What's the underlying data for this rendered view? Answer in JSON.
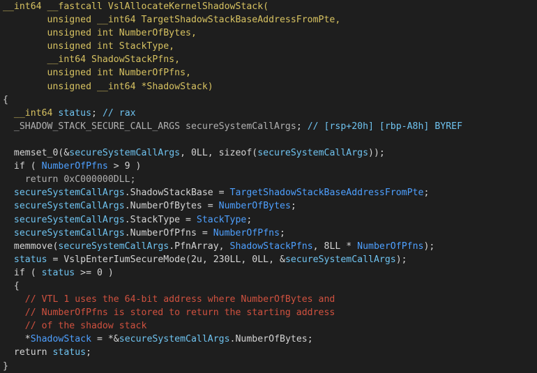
{
  "theme": {
    "background": "#1e1e1e",
    "colors": {
      "keyword": "#d7c261",
      "plain": "#d4d4d4",
      "local": "#6fc3f0",
      "param": "#4ea0ff",
      "type": "#b0b0b0",
      "comment": "#d0513f",
      "brace": "#cfcfcf"
    }
  },
  "code": {
    "lines": [
      [
        {
          "t": "__int64 __fastcall VslAllocateKernelShadowStack(",
          "c": "keyword"
        }
      ],
      [
        {
          "t": "        unsigned __int64 TargetShadowStackBaseAddressFromPte,",
          "c": "keyword"
        }
      ],
      [
        {
          "t": "        unsigned int NumberOfBytes,",
          "c": "keyword"
        }
      ],
      [
        {
          "t": "        unsigned int StackType,",
          "c": "keyword"
        }
      ],
      [
        {
          "t": "        __int64 ShadowStackPfns,",
          "c": "keyword"
        }
      ],
      [
        {
          "t": "        unsigned int NumberOfPfns,",
          "c": "keyword"
        }
      ],
      [
        {
          "t": "        unsigned __int64 *ShadowStack)",
          "c": "keyword"
        }
      ],
      [
        {
          "t": "{",
          "c": "brace"
        }
      ],
      [
        {
          "t": "  __int64 ",
          "c": "keyword"
        },
        {
          "t": "status",
          "c": "local"
        },
        {
          "t": "; ",
          "c": "plain"
        },
        {
          "t": "// rax",
          "c": "local"
        }
      ],
      [
        {
          "t": "  _SHADOW_STACK_SECURE_CALL_ARGS ",
          "c": "type"
        },
        {
          "t": "secureSystemCallArgs",
          "c": "type"
        },
        {
          "t": "; ",
          "c": "plain"
        },
        {
          "t": "// [rsp+20h] [rbp-A8h] BYREF",
          "c": "local"
        }
      ],
      [
        {
          "t": "",
          "c": "plain"
        }
      ],
      [
        {
          "t": "  memset_0(&",
          "c": "plain"
        },
        {
          "t": "secureSystemCallArgs",
          "c": "local"
        },
        {
          "t": ", 0LL, sizeof(",
          "c": "plain"
        },
        {
          "t": "secureSystemCallArgs",
          "c": "local"
        },
        {
          "t": "));",
          "c": "plain"
        }
      ],
      [
        {
          "t": "  if ( ",
          "c": "plain"
        },
        {
          "t": "NumberOfPfns",
          "c": "param"
        },
        {
          "t": " > 9 )",
          "c": "plain"
        }
      ],
      [
        {
          "t": "    return 0xC000000DLL;",
          "c": "type"
        }
      ],
      [
        {
          "t": "  ",
          "c": "plain"
        },
        {
          "t": "secureSystemCallArgs",
          "c": "local"
        },
        {
          "t": ".ShadowStackBase = ",
          "c": "plain"
        },
        {
          "t": "TargetShadowStackBaseAddressFromPte",
          "c": "param"
        },
        {
          "t": ";",
          "c": "plain"
        }
      ],
      [
        {
          "t": "  ",
          "c": "plain"
        },
        {
          "t": "secureSystemCallArgs",
          "c": "local"
        },
        {
          "t": ".NumberOfBytes = ",
          "c": "plain"
        },
        {
          "t": "NumberOfBytes",
          "c": "param"
        },
        {
          "t": ";",
          "c": "plain"
        }
      ],
      [
        {
          "t": "  ",
          "c": "plain"
        },
        {
          "t": "secureSystemCallArgs",
          "c": "local"
        },
        {
          "t": ".StackType = ",
          "c": "plain"
        },
        {
          "t": "StackType",
          "c": "param"
        },
        {
          "t": ";",
          "c": "plain"
        }
      ],
      [
        {
          "t": "  ",
          "c": "plain"
        },
        {
          "t": "secureSystemCallArgs",
          "c": "local"
        },
        {
          "t": ".NumberOfPfns = ",
          "c": "plain"
        },
        {
          "t": "NumberOfPfns",
          "c": "param"
        },
        {
          "t": ";",
          "c": "plain"
        }
      ],
      [
        {
          "t": "  memmove(",
          "c": "plain"
        },
        {
          "t": "secureSystemCallArgs",
          "c": "local"
        },
        {
          "t": ".PfnArray, ",
          "c": "plain"
        },
        {
          "t": "ShadowStackPfns",
          "c": "param"
        },
        {
          "t": ", 8LL * ",
          "c": "plain"
        },
        {
          "t": "NumberOfPfns",
          "c": "param"
        },
        {
          "t": ");",
          "c": "plain"
        }
      ],
      [
        {
          "t": "  ",
          "c": "plain"
        },
        {
          "t": "status",
          "c": "local"
        },
        {
          "t": " = VslpEnterIumSecureMode(2u, 230LL, 0LL, &",
          "c": "plain"
        },
        {
          "t": "secureSystemCallArgs",
          "c": "local"
        },
        {
          "t": ");",
          "c": "plain"
        }
      ],
      [
        {
          "t": "  if ( ",
          "c": "plain"
        },
        {
          "t": "status",
          "c": "local"
        },
        {
          "t": " >= 0 )",
          "c": "plain"
        }
      ],
      [
        {
          "t": "  {",
          "c": "brace"
        }
      ],
      [
        {
          "t": "    // VTL 1 uses the 64-bit address where NumberOfBytes and",
          "c": "comment"
        }
      ],
      [
        {
          "t": "    // NumberOfPfns is stored to return the starting address",
          "c": "comment"
        }
      ],
      [
        {
          "t": "    // of the shadow stack",
          "c": "comment"
        }
      ],
      [
        {
          "t": "    *",
          "c": "plain"
        },
        {
          "t": "ShadowStack",
          "c": "param"
        },
        {
          "t": " = *&",
          "c": "plain"
        },
        {
          "t": "secureSystemCallArgs",
          "c": "local"
        },
        {
          "t": ".NumberOfBytes;",
          "c": "plain"
        }
      ],
      [
        {
          "t": "  return ",
          "c": "plain"
        },
        {
          "t": "status",
          "c": "local"
        },
        {
          "t": ";",
          "c": "plain"
        }
      ],
      [
        {
          "t": "}",
          "c": "brace"
        }
      ]
    ]
  }
}
